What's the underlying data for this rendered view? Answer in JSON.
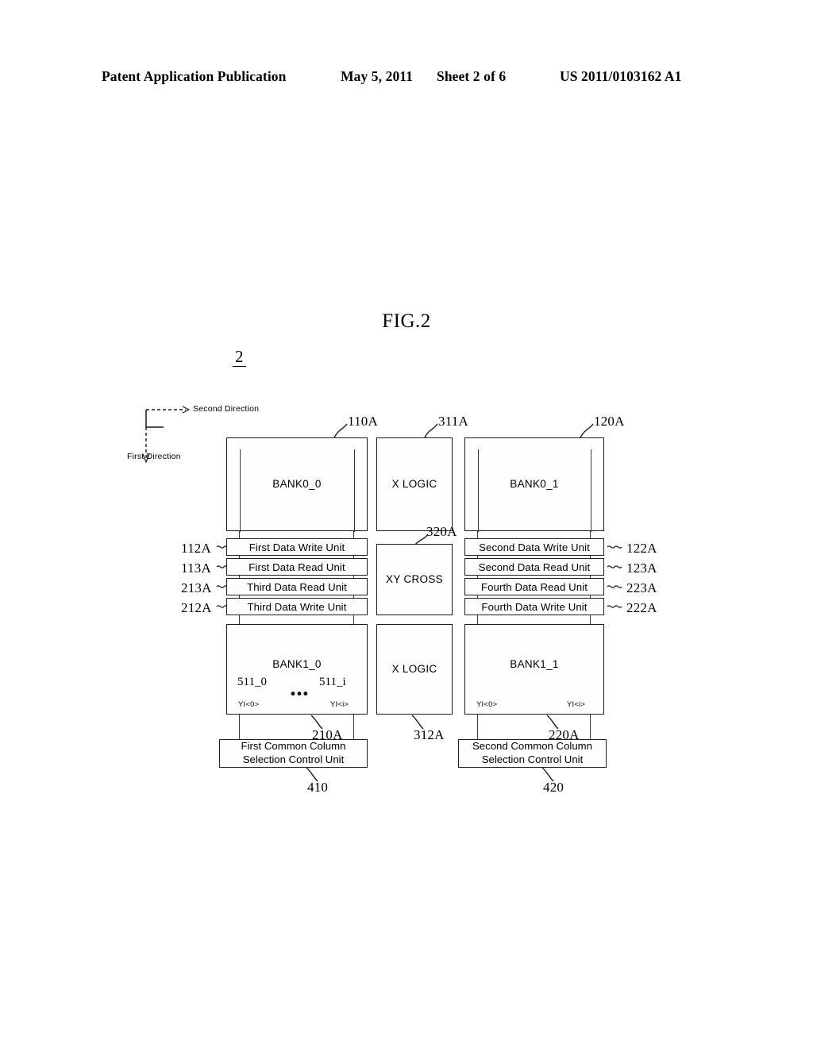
{
  "header": {
    "publication": "Patent Application Publication",
    "date": "May 5, 2011",
    "sheet": "Sheet 2 of 6",
    "patent_number": "US 2011/0103162 A1"
  },
  "figure": {
    "title": "FIG.2",
    "reference": "2"
  },
  "orientation": {
    "second_direction": "Second Direction",
    "first_direction": "First Direction"
  },
  "banks": {
    "bank0_0": {
      "label": "BANK0_0",
      "ref": "110A"
    },
    "bank0_1": {
      "label": "BANK0_1",
      "ref": "120A"
    },
    "bank1_0": {
      "label": "BANK1_0",
      "ref": "210A",
      "cell_left": "511_0",
      "cell_right": "511_i",
      "ellipsis": "•••",
      "yi_left": "YI<0>",
      "yi_right": "YI<i>"
    },
    "bank1_1": {
      "label": "BANK1_1",
      "ref": "220A",
      "yi_left": "YI<0>",
      "yi_right": "YI<i>"
    }
  },
  "logic": {
    "x_logic_top": {
      "label": "X LOGIC",
      "ref": "311A"
    },
    "x_logic_bottom": {
      "label": "X LOGIC",
      "ref": "312A"
    },
    "xy_cross": {
      "label": "XY  CROSS",
      "ref": "320A"
    }
  },
  "left_units": [
    {
      "label": "First Data Write Unit",
      "ref": "112A"
    },
    {
      "label": "First Data Read Unit",
      "ref": "113A"
    },
    {
      "label": "Third Data Read Unit",
      "ref": "213A"
    },
    {
      "label": "Third Data Write Unit",
      "ref": "212A"
    }
  ],
  "right_units": [
    {
      "label": "Second Data Write Unit",
      "ref": "122A"
    },
    {
      "label": "Second Data Read Unit",
      "ref": "123A"
    },
    {
      "label": "Fourth Data Read Unit",
      "ref": "223A"
    },
    {
      "label": "Fourth Data Write Unit",
      "ref": "222A"
    }
  ],
  "control_units": {
    "first": {
      "line1": "First Common Column",
      "line2": "Selection Control Unit",
      "ref": "410"
    },
    "second": {
      "line1": "Second Common Column",
      "line2": "Selection Control Unit",
      "ref": "420"
    }
  },
  "colors": {
    "ink": "#1a1a1a",
    "line": "#3a3a3a",
    "paper": "#ffffff"
  }
}
